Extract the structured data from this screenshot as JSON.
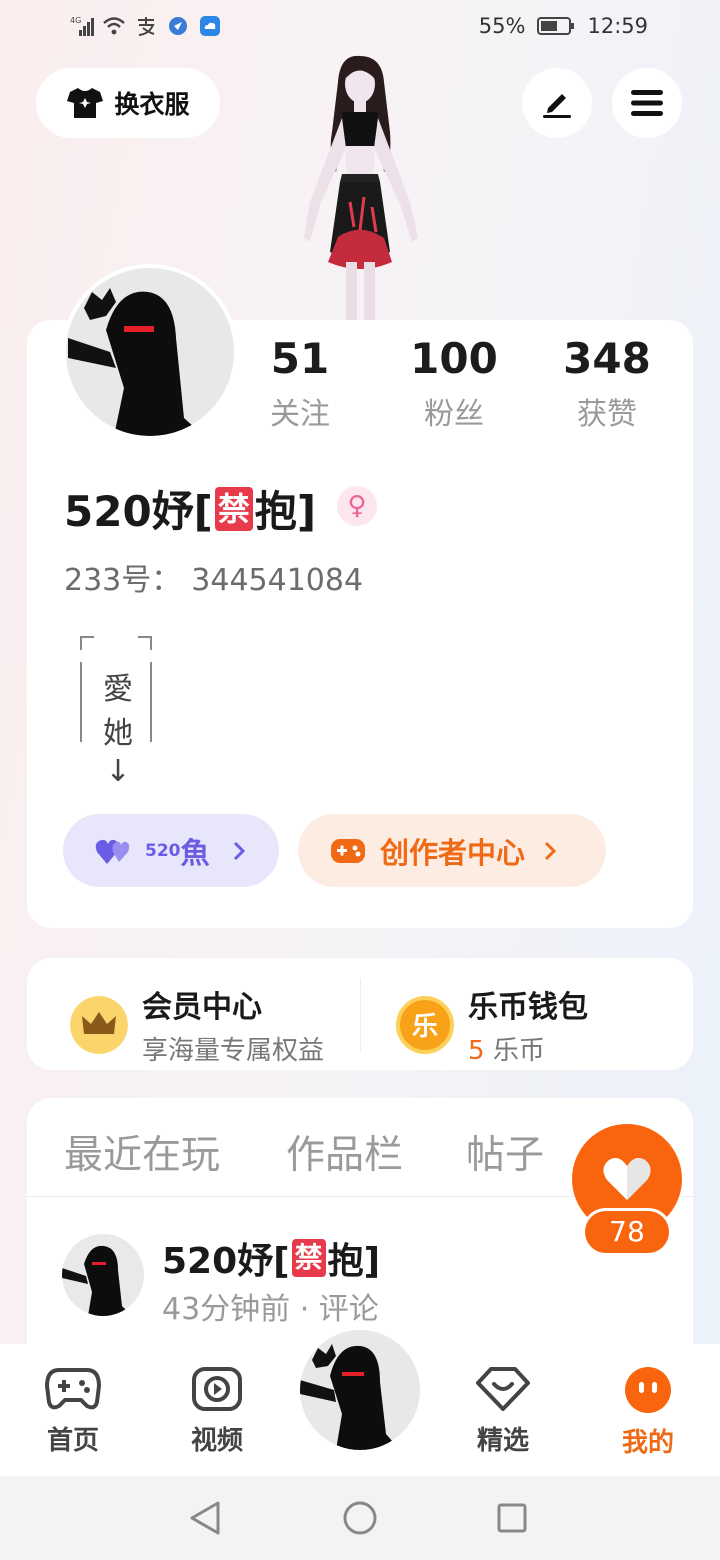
{
  "status_bar": {
    "network": "4G",
    "battery": "55%",
    "time": "12:59"
  },
  "header": {
    "outfit_label": "换衣服"
  },
  "profile": {
    "stats": [
      {
        "value": "51",
        "label": "关注"
      },
      {
        "value": "100",
        "label": "粉丝"
      },
      {
        "value": "348",
        "label": "获赞"
      }
    ],
    "nickname_prefix": "520妤[",
    "nickname_ban": "禁",
    "nickname_suffix": "抱]",
    "gender_symbol": "♀",
    "uid_label": "233号：",
    "uid_value": "344541084",
    "bio_chars": [
      "愛",
      "她"
    ],
    "bio_arrow": "↓",
    "fish_badge": {
      "count": "520",
      "label": "魚"
    },
    "creator_label": "创作者中心"
  },
  "member": {
    "title": "会员中心",
    "subtitle": "享海量专属权益"
  },
  "wallet": {
    "title": "乐币钱包",
    "coin_glyph": "乐",
    "amount": "5",
    "unit": "乐币"
  },
  "tabs": [
    "最近在玩",
    "作品栏",
    "帖子"
  ],
  "post": {
    "name_prefix": "520妤[",
    "name_ban": "禁",
    "name_suffix": "抱]",
    "meta": "43分钟前 · 评论"
  },
  "like_count": "78",
  "bottom_nav": [
    {
      "label": "首页",
      "icon": "gamepad-icon"
    },
    {
      "label": "视频",
      "icon": "video-icon"
    },
    {
      "label": "精选",
      "icon": "heart-badge-icon"
    },
    {
      "label": "我的",
      "icon": "face-icon"
    }
  ],
  "colors": {
    "accent_orange": "#f8650e",
    "purple": "#6b5ce6",
    "ban_red": "#e73a4b"
  }
}
